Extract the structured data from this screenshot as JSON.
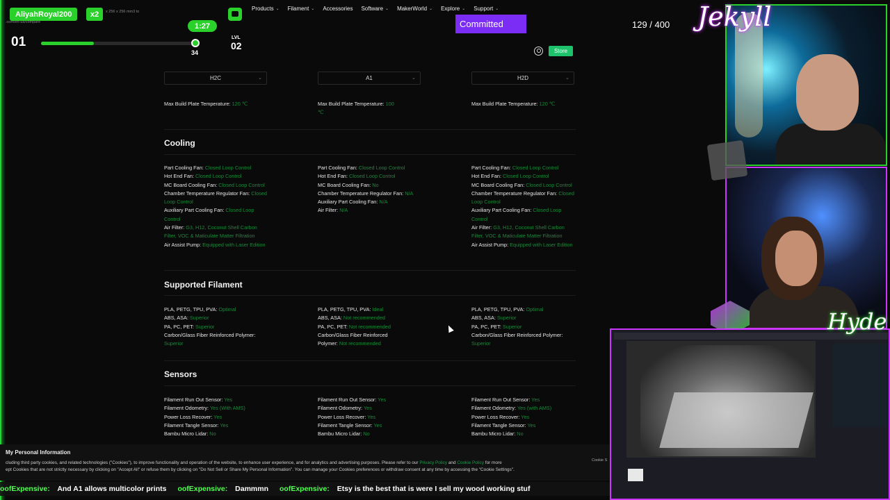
{
  "overlay": {
    "username": "AliyahRoyal200",
    "multiplier": "x2",
    "level_left": "01",
    "timer": "1:27",
    "knob_value": "34",
    "lvl_label": "LVL",
    "lvl_value": "02",
    "progress": 0.34,
    "committed": "Committed",
    "counter": "129 / 400",
    "url": ".com/en-us/compare",
    "url_top": "x 256 x 256 mm3 to",
    "jekyll": "Jekyll",
    "hyde": "Hyde"
  },
  "nav": {
    "items": [
      "Products",
      "Filament",
      "Accessories",
      "Software",
      "MakerWorld",
      "Explore",
      "Support"
    ],
    "store": "Store"
  },
  "selectors": [
    "H2C",
    "A1",
    "H2D"
  ],
  "build_plate": {
    "c1": {
      "k": "Max Build Plate Temperature:",
      "v": "120 ℃"
    },
    "c2": {
      "k": "Max Build Plate Temperature:",
      "v": "100 ℃"
    },
    "c3": {
      "k": "Max Build Plate Temperature:",
      "v": "120 ℃"
    }
  },
  "sections": {
    "cooling": "Cooling",
    "filament": "Supported Filament",
    "sensors": "Sensors"
  },
  "cooling": {
    "c1": [
      {
        "k": "Part Cooling Fan:",
        "v": "Closed Loop Control"
      },
      {
        "k": "Hot End Fan:",
        "v": "Closed Loop Control"
      },
      {
        "k": "MC Board Cooling Fan:",
        "v": "Closed Loop Control"
      },
      {
        "k": "Chamber Temperature Regulator Fan:",
        "v": "Closed Loop Control"
      },
      {
        "k": "Auxiliary Part Cooling Fan:",
        "v": "Closed Loop Control"
      },
      {
        "k": "Air Filter:",
        "v": "G3, H12, Coconut Shell Carbon Filter, VOC & Maticulate Matter Filtration"
      },
      {
        "k": "Air Assist Pump:",
        "v": "Equipped with Laser Edition"
      }
    ],
    "c2": [
      {
        "k": "Part Cooling Fan:",
        "v": "Closed Loop Control"
      },
      {
        "k": "Hot End Fan:",
        "v": "Closed Loop Control"
      },
      {
        "k": "MC Board Cooling Fan:",
        "v": "No"
      },
      {
        "k": "Chamber Temperature Regulator Fan:",
        "v": "N/A"
      },
      {
        "k": "Auxiliary Part Cooling Fan:",
        "v": "N/A"
      },
      {
        "k": "Air Filter:",
        "v": "N/A"
      }
    ],
    "c3": [
      {
        "k": "Part Cooling Fan:",
        "v": "Closed Loop Control"
      },
      {
        "k": "Hot End Fan:",
        "v": "Closed Loop Control"
      },
      {
        "k": "MC Board Cooling Fan:",
        "v": "Closed Loop Control"
      },
      {
        "k": "Chamber Temperature Regulator Fan:",
        "v": "Closed Loop Control"
      },
      {
        "k": "Auxiliary Part Cooling Fan:",
        "v": "Closed Loop Control"
      },
      {
        "k": "Air Filter:",
        "v": "G3, H12, Coconut Shell Carbon Filter, VOC & Maticulate Matter Filtration"
      },
      {
        "k": "Air Assist Pump:",
        "v": "Equipped with Laser Edition"
      }
    ]
  },
  "filament": {
    "c1": [
      {
        "k": "PLA, PETG, TPU, PVA:",
        "v": "Optimal"
      },
      {
        "k": "ABS, ASA:",
        "v": "Superior"
      },
      {
        "k": "PA, PC, PET:",
        "v": "Superior"
      },
      {
        "k": "Carbon/Glass Fiber Reinforced Polymer:",
        "v": "Superior"
      }
    ],
    "c2": [
      {
        "k": "PLA, PETG, TPU, PVA:",
        "v": "Ideal"
      },
      {
        "k": "ABS, ASA:",
        "v": "Not recommended"
      },
      {
        "k": "PA, PC, PET:",
        "v": "Not recommended"
      },
      {
        "k": "Carbon/Glass Fiber Reinforced Polymer:",
        "v": "Not recommended"
      }
    ],
    "c3": [
      {
        "k": "PLA, PETG, TPU, PVA:",
        "v": "Optimal"
      },
      {
        "k": "ABS, ASA:",
        "v": "Superior"
      },
      {
        "k": "PA, PC, PET:",
        "v": "Superior"
      },
      {
        "k": "Carbon/Glass Fiber Reinforced Polymer:",
        "v": "Superior"
      }
    ]
  },
  "sensors": {
    "c1": [
      {
        "k": "Filament Run Out Sensor:",
        "v": "Yes"
      },
      {
        "k": "Filament Odometry:",
        "v": "Yes (With AMS)"
      },
      {
        "k": "Power Loss Recover:",
        "v": "Yes"
      },
      {
        "k": "Filament Tangle Sensor:",
        "v": "Yes"
      },
      {
        "k": "Bambu Micro Lidar:",
        "v": "No"
      }
    ],
    "c2": [
      {
        "k": "Filament Run Out Sensor:",
        "v": "Yes"
      },
      {
        "k": "Filament Odometry:",
        "v": "Yes"
      },
      {
        "k": "Power Loss Recover:",
        "v": "Yes"
      },
      {
        "k": "Filament Tangle Sensor:",
        "v": "Yes"
      },
      {
        "k": "Bambu Micro Lidar:",
        "v": "No"
      }
    ],
    "c3": [
      {
        "k": "Filament Run Out Sensor:",
        "v": "Yes"
      },
      {
        "k": "Filament Odometry:",
        "v": "Yes (with AMS)"
      },
      {
        "k": "Power Loss Recover:",
        "v": "Yes"
      },
      {
        "k": "Filament Tangle Sensor:",
        "v": "Yes"
      },
      {
        "k": "Bambu Micro Lidar:",
        "v": "No"
      }
    ]
  },
  "cookie": {
    "title": "My Personal Information",
    "text_a": "cluding third party cookies, and related technologies (\"Cookies\"), to improve functionality and operation of the website, to enhance user experience, and for analytics and advertising purposes. Please refer to our",
    "link_privacy": "Privacy Policy",
    "and": "and",
    "link_cookie": "Cookie Policy",
    "text_b": "for more",
    "text_c": "ept Cookies that are not strictly necessary by clicking on \"Accept All\" or refuse them by clicking on \"Do Not Sell or Share My Personal Information\". You can manage your Cookies preferences or withdraw consent at any time by accessing the \"Cookie Settings\".",
    "settings": "Cookie S"
  },
  "ticker": [
    {
      "user": "oofExpensive:",
      "msg": "And A1 allows multicolor prints"
    },
    {
      "user": "oofExpensive:",
      "msg": "Dammmn"
    },
    {
      "user": "oofExpensive:",
      "msg": "Etsy is the best that is were I sell my wood working stuf"
    }
  ],
  "colors": {
    "accent_green": "#2bd12b",
    "value_green": "#1a8a3a",
    "purple": "#7b2cf5",
    "store_green": "#1ec26a"
  }
}
